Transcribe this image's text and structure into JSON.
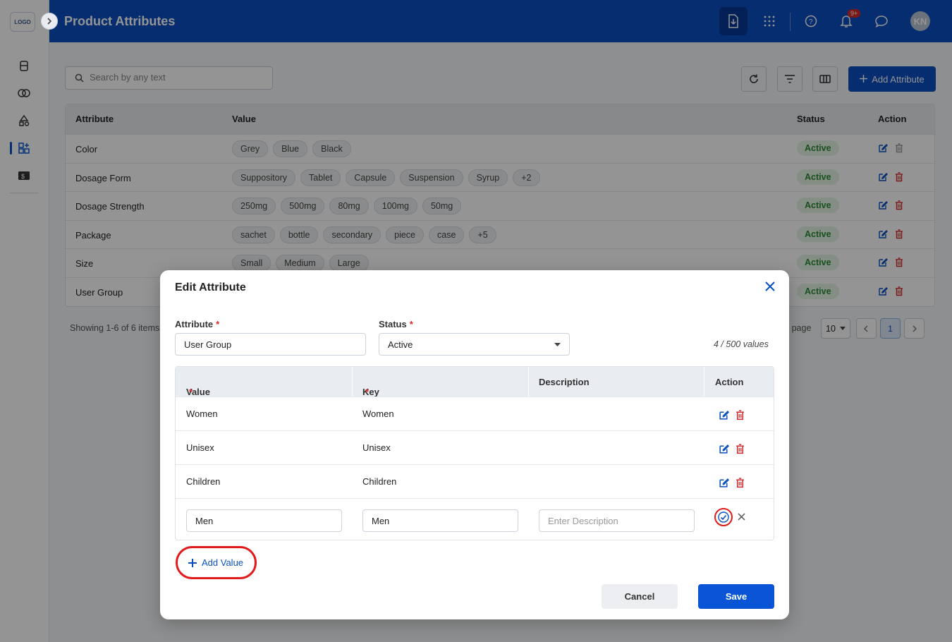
{
  "app": {
    "logo_text": "LOGO",
    "page_title": "Product Attributes"
  },
  "header": {
    "notif_badge": "9+",
    "avatar_initials": "KN"
  },
  "toolbar": {
    "search_placeholder": "Search by any text",
    "add_label": "Add Attribute"
  },
  "table": {
    "headers": {
      "attribute": "Attribute",
      "value": "Value",
      "status": "Status",
      "action": "Action"
    },
    "rows": [
      {
        "name": "Color",
        "chips": [
          "Grey",
          "Blue",
          "Black"
        ],
        "status": "Active"
      },
      {
        "name": "Dosage Form",
        "chips": [
          "Suppository",
          "Tablet",
          "Capsule",
          "Suspension",
          "Syrup",
          "+2"
        ],
        "status": "Active"
      },
      {
        "name": "Dosage Strength",
        "chips": [
          "250mg",
          "500mg",
          "80mg",
          "100mg",
          "50mg"
        ],
        "status": "Active"
      },
      {
        "name": "Package",
        "chips": [
          "sachet",
          "bottle",
          "secondary",
          "piece",
          "case",
          "+5"
        ],
        "status": "Active"
      },
      {
        "name": "Size",
        "chips": [
          "Small",
          "Medium",
          "Large"
        ],
        "status": "Active"
      },
      {
        "name": "User Group",
        "chips": [],
        "status": "Active"
      }
    ]
  },
  "pagination": {
    "showing": "Showing 1-6 of 6 items",
    "per_page_label": "er page",
    "per_page_value": "10",
    "current_page": "1"
  },
  "modal": {
    "title": "Edit Attribute",
    "attribute_label": "Attribute",
    "attribute_value": "User Group",
    "status_label": "Status",
    "status_value": "Active",
    "values_count": "4 / 500 values",
    "columns": {
      "value": "Value",
      "key": "Key",
      "description": "Description",
      "action": "Action"
    },
    "rows": [
      {
        "value": "Women",
        "key": "Women"
      },
      {
        "value": "Unisex",
        "key": "Unisex"
      },
      {
        "value": "Children",
        "key": "Children"
      }
    ],
    "edit_row": {
      "value": "Men",
      "key": "Men",
      "description_placeholder": "Enter Description"
    },
    "add_value_label": "Add Value",
    "cancel_label": "Cancel",
    "save_label": "Save"
  },
  "colors": {
    "primary": "#0a4fc2",
    "active_green": "#2e8b34",
    "danger": "#d62828",
    "highlight_ring": "#e11b1b"
  }
}
